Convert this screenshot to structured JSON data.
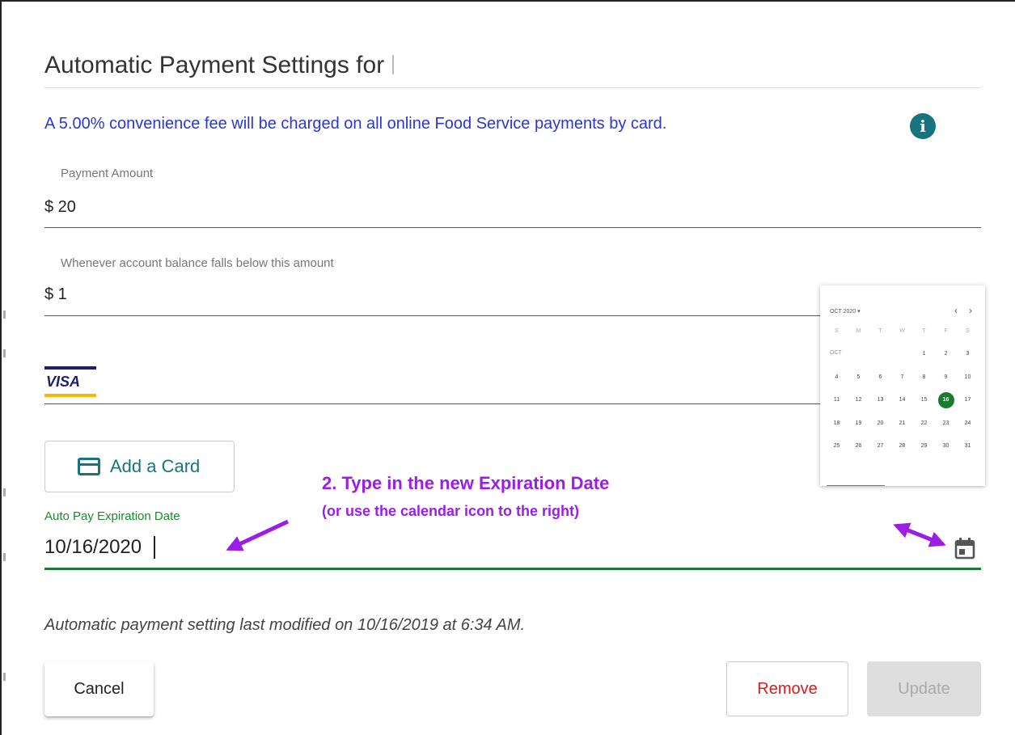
{
  "dialog": {
    "title": "Automatic Payment Settings for",
    "fee_notice": "A 5.00% convenience fee will be charged on all online Food Service payments by card."
  },
  "payment_amount": {
    "label": "Payment Amount",
    "value": "$ 20"
  },
  "threshold": {
    "label": "Whenever account balance falls below this amount",
    "value": "$ 1"
  },
  "card": {
    "brand": "VISA"
  },
  "add_card": {
    "label": "Add a Card"
  },
  "expiration": {
    "label": "Auto Pay Expiration Date",
    "value": "10/16/2020"
  },
  "annotation": {
    "main": "2. Type in the new Expiration Date",
    "sub": "(or use the calendar icon to the right)"
  },
  "last_modified": "Automatic payment setting last modified on 10/16/2019 at 6:34 AM.",
  "buttons": {
    "cancel": "Cancel",
    "remove": "Remove",
    "update": "Update"
  },
  "calendar": {
    "header": "OCT 2020 ▾",
    "prev": "‹",
    "next": "›",
    "weekdays": [
      "S",
      "M",
      "T",
      "W",
      "T",
      "F",
      "S"
    ],
    "month_label": "OCT",
    "leading_blanks": 4,
    "days": [
      "1",
      "2",
      "3",
      "4",
      "5",
      "6",
      "7",
      "8",
      "9",
      "10",
      "11",
      "12",
      "13",
      "14",
      "15",
      "16",
      "17",
      "18",
      "19",
      "20",
      "21",
      "22",
      "23",
      "24",
      "25",
      "26",
      "27",
      "28",
      "29",
      "30",
      "31"
    ],
    "selected_day": "16"
  },
  "colors": {
    "accent": "#17747f",
    "notice": "#2a36d6",
    "success": "#1a7a2e",
    "annotation": "#9a1ee8",
    "danger": "#d02020"
  },
  "icons": {
    "info": "info-icon",
    "card": "credit-card-icon",
    "calendar": "calendar-icon"
  }
}
